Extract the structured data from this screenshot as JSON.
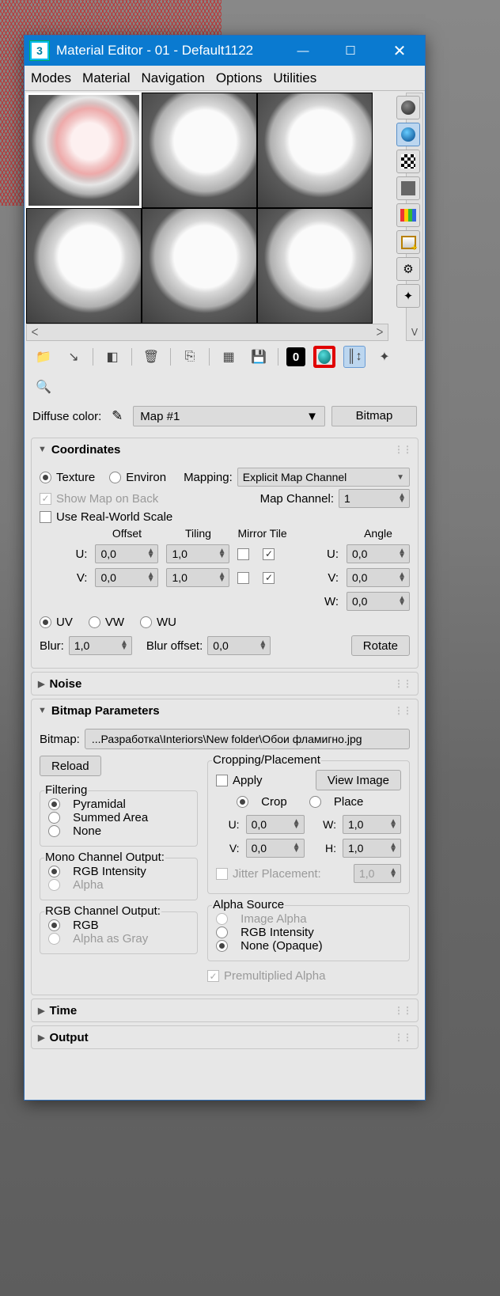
{
  "window": {
    "app_initial": "3",
    "title": "Material Editor - 01 - Default1122",
    "min": "—",
    "max": "☐",
    "close": "✕"
  },
  "menus": [
    "Modes",
    "Material",
    "Navigation",
    "Options",
    "Utilities"
  ],
  "scroll": {
    "up": "ᐱ",
    "down": "ᐯ",
    "left": "ᐸ",
    "right": "ᐳ"
  },
  "mapbar": {
    "label": "Diffuse color:",
    "name": "Map #1",
    "type": "Bitmap",
    "dd": "▼"
  },
  "coord": {
    "title": "Coordinates",
    "texture": "Texture",
    "environ": "Environ",
    "mapping_lbl": "Mapping:",
    "mapping_val": "Explicit Map Channel",
    "show_map": "Show Map on Back",
    "map_channel_lbl": "Map Channel:",
    "map_channel_val": "1",
    "use_rw": "Use Real-World Scale",
    "hdr_offset": "Offset",
    "hdr_tiling": "Tiling",
    "hdr_mirror": "Mirror",
    "hdr_tile": "Tile",
    "hdr_angle": "Angle",
    "u": "U:",
    "v": "V:",
    "w": "W:",
    "ou": "0,0",
    "ov": "0,0",
    "tu": "1,0",
    "tv": "1,0",
    "au": "0,0",
    "av": "0,0",
    "aw": "0,0",
    "uv": "UV",
    "vw": "VW",
    "wu": "WU",
    "blur_lbl": "Blur:",
    "blur": "1,0",
    "bluro_lbl": "Blur offset:",
    "bluro": "0,0",
    "rotate": "Rotate"
  },
  "noise": {
    "title": "Noise"
  },
  "bmp": {
    "title": "Bitmap Parameters",
    "path_lbl": "Bitmap:",
    "path": "...Разработка\\Interiors\\New folder\\Обои фламигно.jpg",
    "reload": "Reload",
    "filter_title": "Filtering",
    "f1": "Pyramidal",
    "f2": "Summed Area",
    "f3": "None",
    "mono_title": "Mono Channel Output:",
    "m1": "RGB Intensity",
    "m2": "Alpha",
    "rgb_title": "RGB Channel Output:",
    "r1": "RGB",
    "r2": "Alpha as Gray",
    "cp_title": "Cropping/Placement",
    "apply": "Apply",
    "view": "View Image",
    "crop": "Crop",
    "place": "Place",
    "cu": "0,0",
    "cv": "0,0",
    "cw": "1,0",
    "ch": "1,0",
    "jitter_lbl": "Jitter Placement:",
    "jitter": "1,0",
    "alpha_title": "Alpha Source",
    "a1": "Image Alpha",
    "a2": "RGB Intensity",
    "a3": "None (Opaque)",
    "premult": "Premultiplied Alpha",
    "ulab": "U:",
    "vlab": "V:",
    "wlab": "W:",
    "hlab": "H:"
  },
  "time": {
    "title": "Time"
  },
  "output": {
    "title": "Output"
  }
}
